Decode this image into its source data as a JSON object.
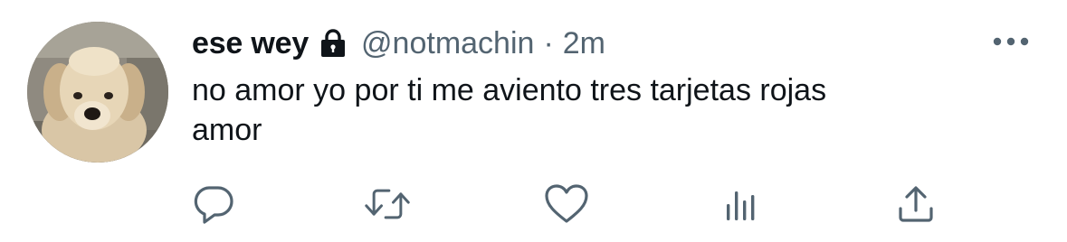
{
  "tweet": {
    "display_name": "ese wey",
    "handle": "@notmachin",
    "separator": "·",
    "time": "2m",
    "text_line1": "no amor yo por ti me aviento tres tarjetas rojas",
    "text_line2": "amor"
  },
  "icons": {
    "lock": "lock-icon",
    "more": "more-horizontal-icon",
    "reply": "speech-bubble-icon",
    "retweet": "retweet-arrows-icon",
    "like": "heart-icon",
    "stats": "bar-chart-icon",
    "share": "share-upload-icon"
  },
  "colors": {
    "text": "#0f1419",
    "secondary": "#536471"
  }
}
